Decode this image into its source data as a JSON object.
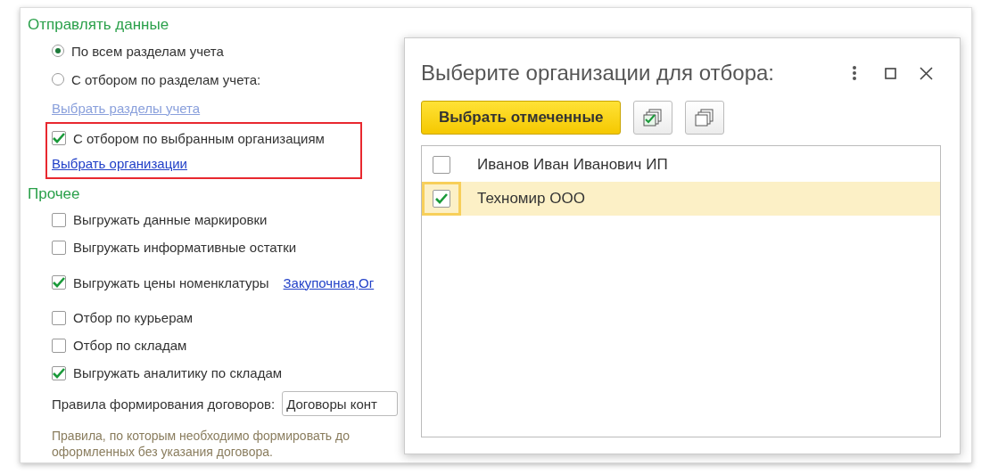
{
  "send_section": {
    "title": "Отправлять данные",
    "radios": [
      {
        "label": "По всем разделам учета",
        "selected": true
      },
      {
        "label": "С отбором по разделам учета:",
        "selected": false
      }
    ],
    "sections_link": {
      "label": "Выбрать разделы учета",
      "disabled": true
    },
    "org_filter": {
      "label": "С отбором по выбранным организациям",
      "checked": true,
      "highlighted": true,
      "link": "Выбрать организации"
    }
  },
  "other_section": {
    "title": "Прочее",
    "options": [
      {
        "label": "Выгружать данные маркировки",
        "checked": false
      },
      {
        "label": "Выгружать информативные остатки",
        "checked": false
      },
      {
        "label": "Выгружать цены номенклатуры",
        "checked": true,
        "link": "Закупочная,Ог"
      },
      {
        "label": "Отбор по курьерам",
        "checked": false
      },
      {
        "label": "Отбор по складам",
        "checked": false
      },
      {
        "label": "Выгружать аналитику по складам",
        "checked": true
      }
    ],
    "contracts": {
      "label": "Правила формирования договоров:",
      "value": "Договоры конт"
    },
    "hint": [
      "Правила, по которым необходимо формировать до",
      "оформленных без указания договора."
    ]
  },
  "dialog": {
    "title": "Выберите организации для отбора:",
    "select_button": "Выбрать отмеченные",
    "organizations": [
      {
        "name": "Иванов Иван Иванович ИП",
        "checked": false,
        "selected": false
      },
      {
        "name": "Техномир ООО",
        "checked": true,
        "selected": true
      }
    ]
  }
}
